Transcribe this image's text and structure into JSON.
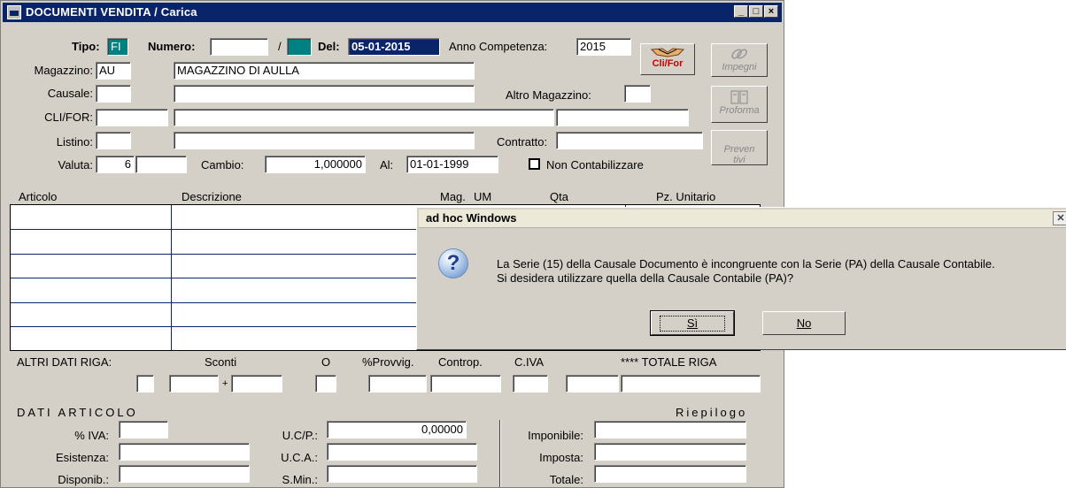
{
  "window": {
    "title": "DOCUMENTI VENDITA / Carica"
  },
  "header": {
    "tipo_label": "Tipo:",
    "tipo_value": "FI",
    "numero_label": "Numero:",
    "numero_value": "",
    "numero_sep": "/",
    "numero_serie": "",
    "del_label": "Del:",
    "del_value": "05-01-2015",
    "anno_label": "Anno Competenza:",
    "anno_value": "2015",
    "magazzino_label": "Magazzino:",
    "magazzino_code": "AU",
    "magazzino_desc": "MAGAZZINO DI AULLA",
    "causale_label": "Causale:",
    "altro_magazzino_label": "Altro Magazzino:",
    "clifor_label": "CLI/FOR:",
    "listino_label": "Listino:",
    "contratto_label": "Contratto:",
    "valuta_label": "Valuta:",
    "valuta_value": "6",
    "cambio_label": "Cambio:",
    "cambio_value": "1,000000",
    "al_label": "Al:",
    "al_value": "01-01-1999",
    "non_contab_label": "Non Contabilizzare"
  },
  "toolbar": {
    "clifor_btn": "Cli/For",
    "impegni_btn": "Impegni",
    "proforma_btn": "Proforma",
    "preventivi_btn": "Preven\ntivi"
  },
  "grid": {
    "columns": [
      "Articolo",
      "Descrizione",
      "Mag.",
      "UM",
      "Qta",
      "Pz. Unitario"
    ]
  },
  "riga": {
    "altri_dati": "ALTRI DATI RIGA:",
    "sconti": "Sconti",
    "o": "O",
    "provvig": "%Provvig.",
    "controp": "Controp.",
    "civa": "C.IVA",
    "totale_riga": "**** TOTALE RIGA",
    "plus": "+"
  },
  "articolo": {
    "title": "DATI ARTICOLO",
    "riepilogo": "Riepilogo",
    "iva_label": "% IVA:",
    "esistenza_label": "Esistenza:",
    "disponib_label": "Disponib.:",
    "ucp_label": "U.C/P.:",
    "ucp_value": "0,00000",
    "uca_label": "U.C.A.:",
    "smin_label": "S.Min.:",
    "imponibile_label": "Imponibile:",
    "imposta_label": "Imposta:",
    "totale_label": "Totale:"
  },
  "dialog": {
    "title": "ad hoc Windows",
    "line1": "La Serie (15) della Causale Documento è incongruente con la Serie (PA) della Causale Contabile.",
    "line2": "Si desidera utilizzare quella della Causale Contabile (PA)?",
    "yes": "Sì",
    "no": "No"
  }
}
